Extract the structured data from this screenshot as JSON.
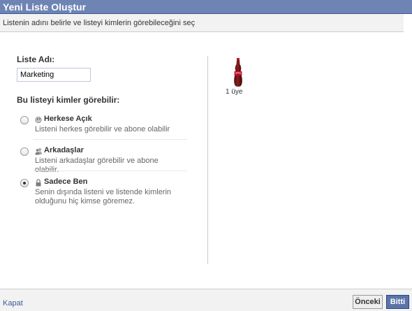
{
  "dialog": {
    "title": "Yeni Liste Oluştur",
    "subtitle": "Listenin adını belirle ve listeyi kimlerin görebileceğini seç"
  },
  "form": {
    "name_label": "Liste Adı:",
    "name_value": "Marketing",
    "visibility_label": "Bu listeyi kimler görebilir:",
    "options": [
      {
        "title": "Herkese Açık",
        "description": "Listeni herkes görebilir ve abone olabilir",
        "icon": "globe-icon",
        "selected": false
      },
      {
        "title": "Arkadaşlar",
        "description": "Listeni arkadaşlar görebilir ve abone olabilir.",
        "icon": "friends-icon",
        "selected": false
      },
      {
        "title": "Sadece Ben",
        "description": "Senin dışında listeni ve listende kimlerin olduğunu hiç kimse göremez.",
        "icon": "lock-icon",
        "selected": true
      }
    ]
  },
  "preview": {
    "member_count": "1 üye",
    "icon": "coke-bottle-icon"
  },
  "footer": {
    "close_label": "Kapat",
    "prev_label": "Önceki",
    "done_label": "Bitti"
  },
  "colors": {
    "titlebar": "#6d84b4",
    "primary_button": "#5b74a8",
    "link": "#3b5998"
  }
}
